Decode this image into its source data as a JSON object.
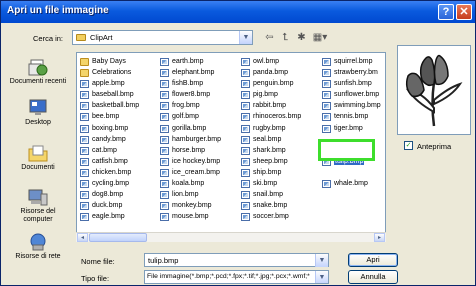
{
  "window": {
    "title": "Apri un file immagine"
  },
  "titlebar": {
    "help": "?",
    "close": "✕"
  },
  "look_in": {
    "label": "Cerca in:",
    "value": "ClipArt"
  },
  "toolbar": {
    "back": "⇦",
    "up": "⮤",
    "new_folder": "✱",
    "views": "▦▾"
  },
  "places": [
    {
      "label": "Documenti recenti",
      "icon": "recent-documents-icon"
    },
    {
      "label": "Desktop",
      "icon": "desktop-icon"
    },
    {
      "label": "Documenti",
      "icon": "documents-icon"
    },
    {
      "label": "Risorse del computer",
      "icon": "computer-icon"
    },
    {
      "label": "Risorse di rete",
      "icon": "network-icon"
    }
  ],
  "files": {
    "col1": [
      {
        "name": "Baby Days",
        "type": "folder"
      },
      {
        "name": "Celebrations",
        "type": "folder"
      },
      {
        "name": "apple.bmp",
        "type": "bmp"
      },
      {
        "name": "baseball.bmp",
        "type": "bmp"
      },
      {
        "name": "basketball.bmp",
        "type": "bmp"
      },
      {
        "name": "bee.bmp",
        "type": "bmp"
      },
      {
        "name": "boxing.bmp",
        "type": "bmp"
      },
      {
        "name": "candy.bmp",
        "type": "bmp"
      },
      {
        "name": "cat.bmp",
        "type": "bmp"
      },
      {
        "name": "catfish.bmp",
        "type": "bmp"
      },
      {
        "name": "chicken.bmp",
        "type": "bmp"
      },
      {
        "name": "cycling.bmp",
        "type": "bmp"
      },
      {
        "name": "dog8.bmp",
        "type": "bmp"
      },
      {
        "name": "duck.bmp",
        "type": "bmp"
      },
      {
        "name": "eagle.bmp",
        "type": "bmp"
      }
    ],
    "col2": [
      {
        "name": "earth.bmp",
        "type": "bmp"
      },
      {
        "name": "elephant.bmp",
        "type": "bmp"
      },
      {
        "name": "fishB.bmp",
        "type": "bmp"
      },
      {
        "name": "flower8.bmp",
        "type": "bmp"
      },
      {
        "name": "frog.bmp",
        "type": "bmp"
      },
      {
        "name": "golf.bmp",
        "type": "bmp"
      },
      {
        "name": "gorilla.bmp",
        "type": "bmp"
      },
      {
        "name": "hamburger.bmp",
        "type": "bmp"
      },
      {
        "name": "horse.bmp",
        "type": "bmp"
      },
      {
        "name": "ice hockey.bmp",
        "type": "bmp"
      },
      {
        "name": "ice_cream.bmp",
        "type": "bmp"
      },
      {
        "name": "koala.bmp",
        "type": "bmp"
      },
      {
        "name": "lion.bmp",
        "type": "bmp"
      },
      {
        "name": "monkey.bmp",
        "type": "bmp"
      },
      {
        "name": "mouse.bmp",
        "type": "bmp"
      }
    ],
    "col3": [
      {
        "name": "owl.bmp",
        "type": "bmp"
      },
      {
        "name": "panda.bmp",
        "type": "bmp"
      },
      {
        "name": "penguin.bmp",
        "type": "bmp"
      },
      {
        "name": "pig.bmp",
        "type": "bmp"
      },
      {
        "name": "rabbit.bmp",
        "type": "bmp"
      },
      {
        "name": "rhinoceros.bmp",
        "type": "bmp"
      },
      {
        "name": "rugby.bmp",
        "type": "bmp"
      },
      {
        "name": "seal.bmp",
        "type": "bmp"
      },
      {
        "name": "shark.bmp",
        "type": "bmp"
      },
      {
        "name": "sheep.bmp",
        "type": "bmp"
      },
      {
        "name": "ship.bmp",
        "type": "bmp"
      },
      {
        "name": "ski.bmp",
        "type": "bmp"
      },
      {
        "name": "snail.bmp",
        "type": "bmp"
      },
      {
        "name": "snake.bmp",
        "type": "bmp"
      },
      {
        "name": "soccer.bmp",
        "type": "bmp"
      }
    ],
    "col4": [
      {
        "name": "squirrel.bmp",
        "type": "bmp"
      },
      {
        "name": "strawberry.bm",
        "type": "bmp"
      },
      {
        "name": "sunfish.bmp",
        "type": "bmp"
      },
      {
        "name": "sunflower.bmp",
        "type": "bmp"
      },
      {
        "name": "swimming.bmp",
        "type": "bmp"
      },
      {
        "name": "tennis.bmp",
        "type": "bmp"
      },
      {
        "name": "tiger.bmp",
        "type": "bmp"
      },
      {
        "name": "",
        "type": "none"
      },
      {
        "name": "",
        "type": "none"
      },
      {
        "name": "tulip.bmp",
        "type": "bmp",
        "selected": true
      },
      {
        "name": "",
        "type": "none"
      },
      {
        "name": "whale.bmp",
        "type": "bmp"
      }
    ]
  },
  "scroll": {
    "left": "◂",
    "right": "▸"
  },
  "file_name": {
    "label": "Nome file:",
    "value": "tulip.bmp"
  },
  "file_type": {
    "label": "Tipo file:",
    "value": "File immagine(*.bmp;*.pcd;*.fpx;*.tif;*.jpg;*.pcx;*.wmf;*"
  },
  "buttons": {
    "open": "Apri",
    "cancel": "Annulla"
  },
  "preview": {
    "label": "Anteprima",
    "checked": true,
    "check_mark": "✓"
  },
  "colors": {
    "title_bar": "#0a5ade",
    "selection": "#316ac5",
    "highlight_box": "#3ede2c"
  }
}
